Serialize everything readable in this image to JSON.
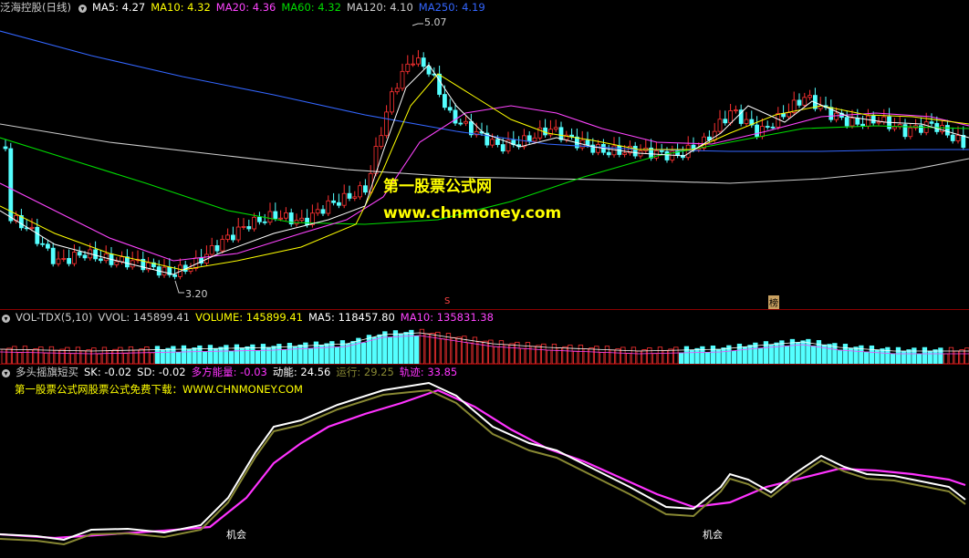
{
  "main": {
    "stock": "泛海控股(日线)",
    "ma": [
      {
        "label": "MA5: 4.27",
        "color": "#ffffff"
      },
      {
        "label": "MA10: 4.32",
        "color": "#ffff00"
      },
      {
        "label": "MA20: 4.36",
        "color": "#ff44ff"
      },
      {
        "label": "MA60: 4.32",
        "color": "#00dd00"
      },
      {
        "label": "MA120: 4.10",
        "color": "#cccccc"
      },
      {
        "label": "MA250: 4.19",
        "color": "#3366ff"
      }
    ],
    "high_label": "5.07",
    "low_label": "3.20",
    "marker_s": "S",
    "marker_bang": "榜",
    "watermark_title": "第一股票公式网",
    "watermark_url": "www.chnmoney.com"
  },
  "volume": {
    "name": "VOL-TDX(5,10)",
    "vvol": "VVOL: 145899.41",
    "vol": "VOLUME: 145899.41",
    "ma5": "MA5: 118457.80",
    "ma10": "MA10: 135831.38"
  },
  "indicator": {
    "name": "多头摇旗短买",
    "sk": "SK: -0.02",
    "sd": "SD: -0.02",
    "power": "多方能量: -0.03",
    "energy": "动能: 24.56",
    "run": "运行: 29.25",
    "track": "轨迹: 33.85",
    "promo": "第一股票公式网股票公式免费下载：WWW.CHNMONEY.COM",
    "opportunity_1": "机会",
    "opportunity_2": "机会"
  },
  "colors": {
    "up": "#ff3232",
    "down": "#54ffff",
    "ma5": "#ffffff",
    "ma10": "#ffff00",
    "ma20": "#ff44ff",
    "ma60": "#00dd00",
    "ma120": "#cccccc",
    "ma250": "#3366ff",
    "sk": "#ffffff",
    "sd": "#888833",
    "track": "#ff33ff"
  }
}
